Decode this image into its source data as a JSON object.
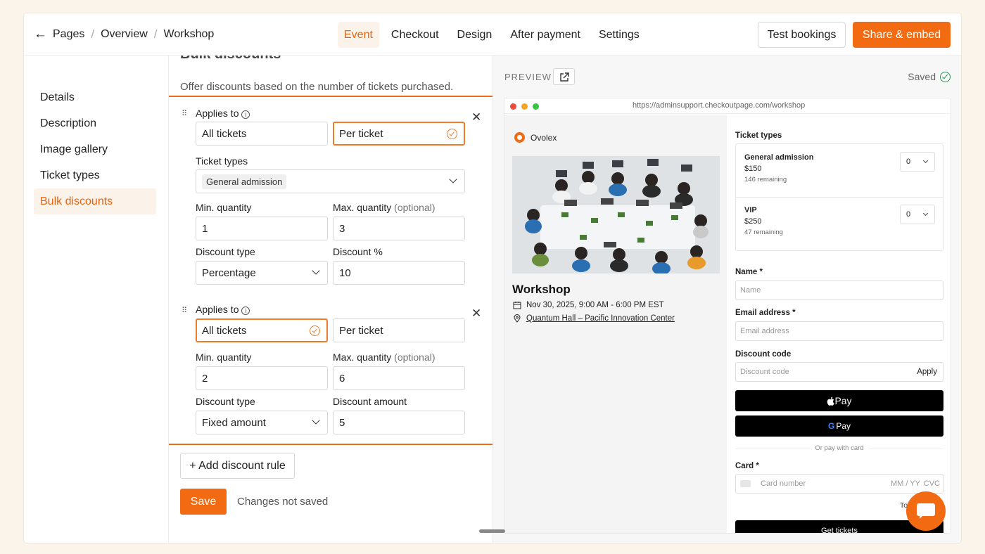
{
  "breadcrumb": {
    "items": [
      "Pages",
      "Overview",
      "Workshop"
    ]
  },
  "tabs": [
    "Event",
    "Checkout",
    "Design",
    "After payment",
    "Settings"
  ],
  "header": {
    "test_label": "Test bookings",
    "share_label": "Share & embed"
  },
  "sidebar": {
    "items": [
      "Details",
      "Description",
      "Image gallery",
      "Ticket types",
      "Bulk discounts"
    ]
  },
  "main": {
    "heading": "Bulk discounts",
    "description": "Offer discounts based on the number of tickets purchased.",
    "rules": [
      {
        "applies_label": "Applies to",
        "applies_to": "All tickets",
        "per": "Per ticket",
        "ticket_types_label": "Ticket types",
        "ticket_type_chip": "General admission",
        "min_label": "Min. quantity",
        "min": "1",
        "max_label": "Max. quantity",
        "max_optional": "(optional)",
        "max": "3",
        "type_label": "Discount type",
        "type": "Percentage",
        "value_label": "Discount %",
        "value": "10"
      },
      {
        "applies_label": "Applies to",
        "applies_to": "All tickets",
        "per": "Per ticket",
        "min_label": "Min. quantity",
        "min": "2",
        "max_label": "Max. quantity",
        "max_optional": "(optional)",
        "max": "6",
        "type_label": "Discount type",
        "type": "Fixed amount",
        "value_label": "Discount amount",
        "value": "5"
      }
    ],
    "add_rule": "+ Add discount rule",
    "save": "Save",
    "unsaved": "Changes not saved"
  },
  "preview": {
    "label": "PREVIEW",
    "saved": "Saved",
    "url": "https://adminsupport.checkoutpage.com/workshop",
    "brand": "Ovolex",
    "event_title": "Workshop",
    "date": "Nov 30, 2025, 9:00 AM - 6:00 PM EST",
    "location": "Quantum Hall – Pacific Innovation Center",
    "ticket_types_label": "Ticket types",
    "tickets": [
      {
        "name": "General admission",
        "price": "$150",
        "remaining": "146 remaining",
        "qty": "0"
      },
      {
        "name": "VIP",
        "price": "$250",
        "remaining": "47 remaining",
        "qty": "0"
      }
    ],
    "name_label": "Name",
    "name_placeholder": "Name",
    "email_label": "Email address",
    "email_placeholder": "Email address",
    "discount_label": "Discount code",
    "discount_placeholder": "Discount code",
    "apply": "Apply",
    "apple_pay": "Pay",
    "google_pay": "Pay",
    "or_card": "Or pay with card",
    "card_label": "Card",
    "card_placeholder": "Card number",
    "card_exp": "MM / YY",
    "card_cvc": "CVC",
    "total_partial": "To",
    "get_tickets": "Get tickets"
  },
  "colors": {
    "accent": "#f26b12",
    "accent_text": "#e8650f",
    "accent_bg": "#fbf2ea"
  }
}
